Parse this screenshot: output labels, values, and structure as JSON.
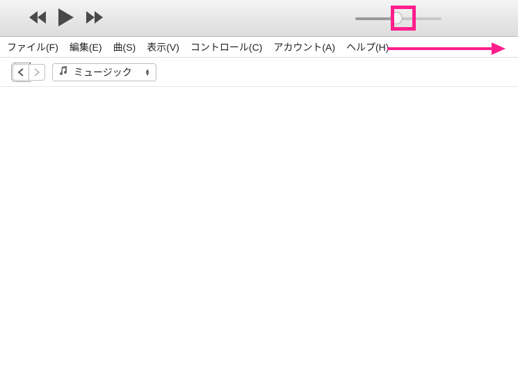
{
  "menu": {
    "file": "ファイル(F)",
    "edit": "編集(E)",
    "song": "曲(S)",
    "view": "表示(V)",
    "controls": "コントロール(C)",
    "account": "アカウント(A)",
    "help": "ヘルプ(H)"
  },
  "library": {
    "selected": "ミュージック",
    "icon": "music-note-icon"
  },
  "volume": {
    "value": 0.5
  },
  "annotations": {
    "highlight_color": "#ff1e8c"
  }
}
